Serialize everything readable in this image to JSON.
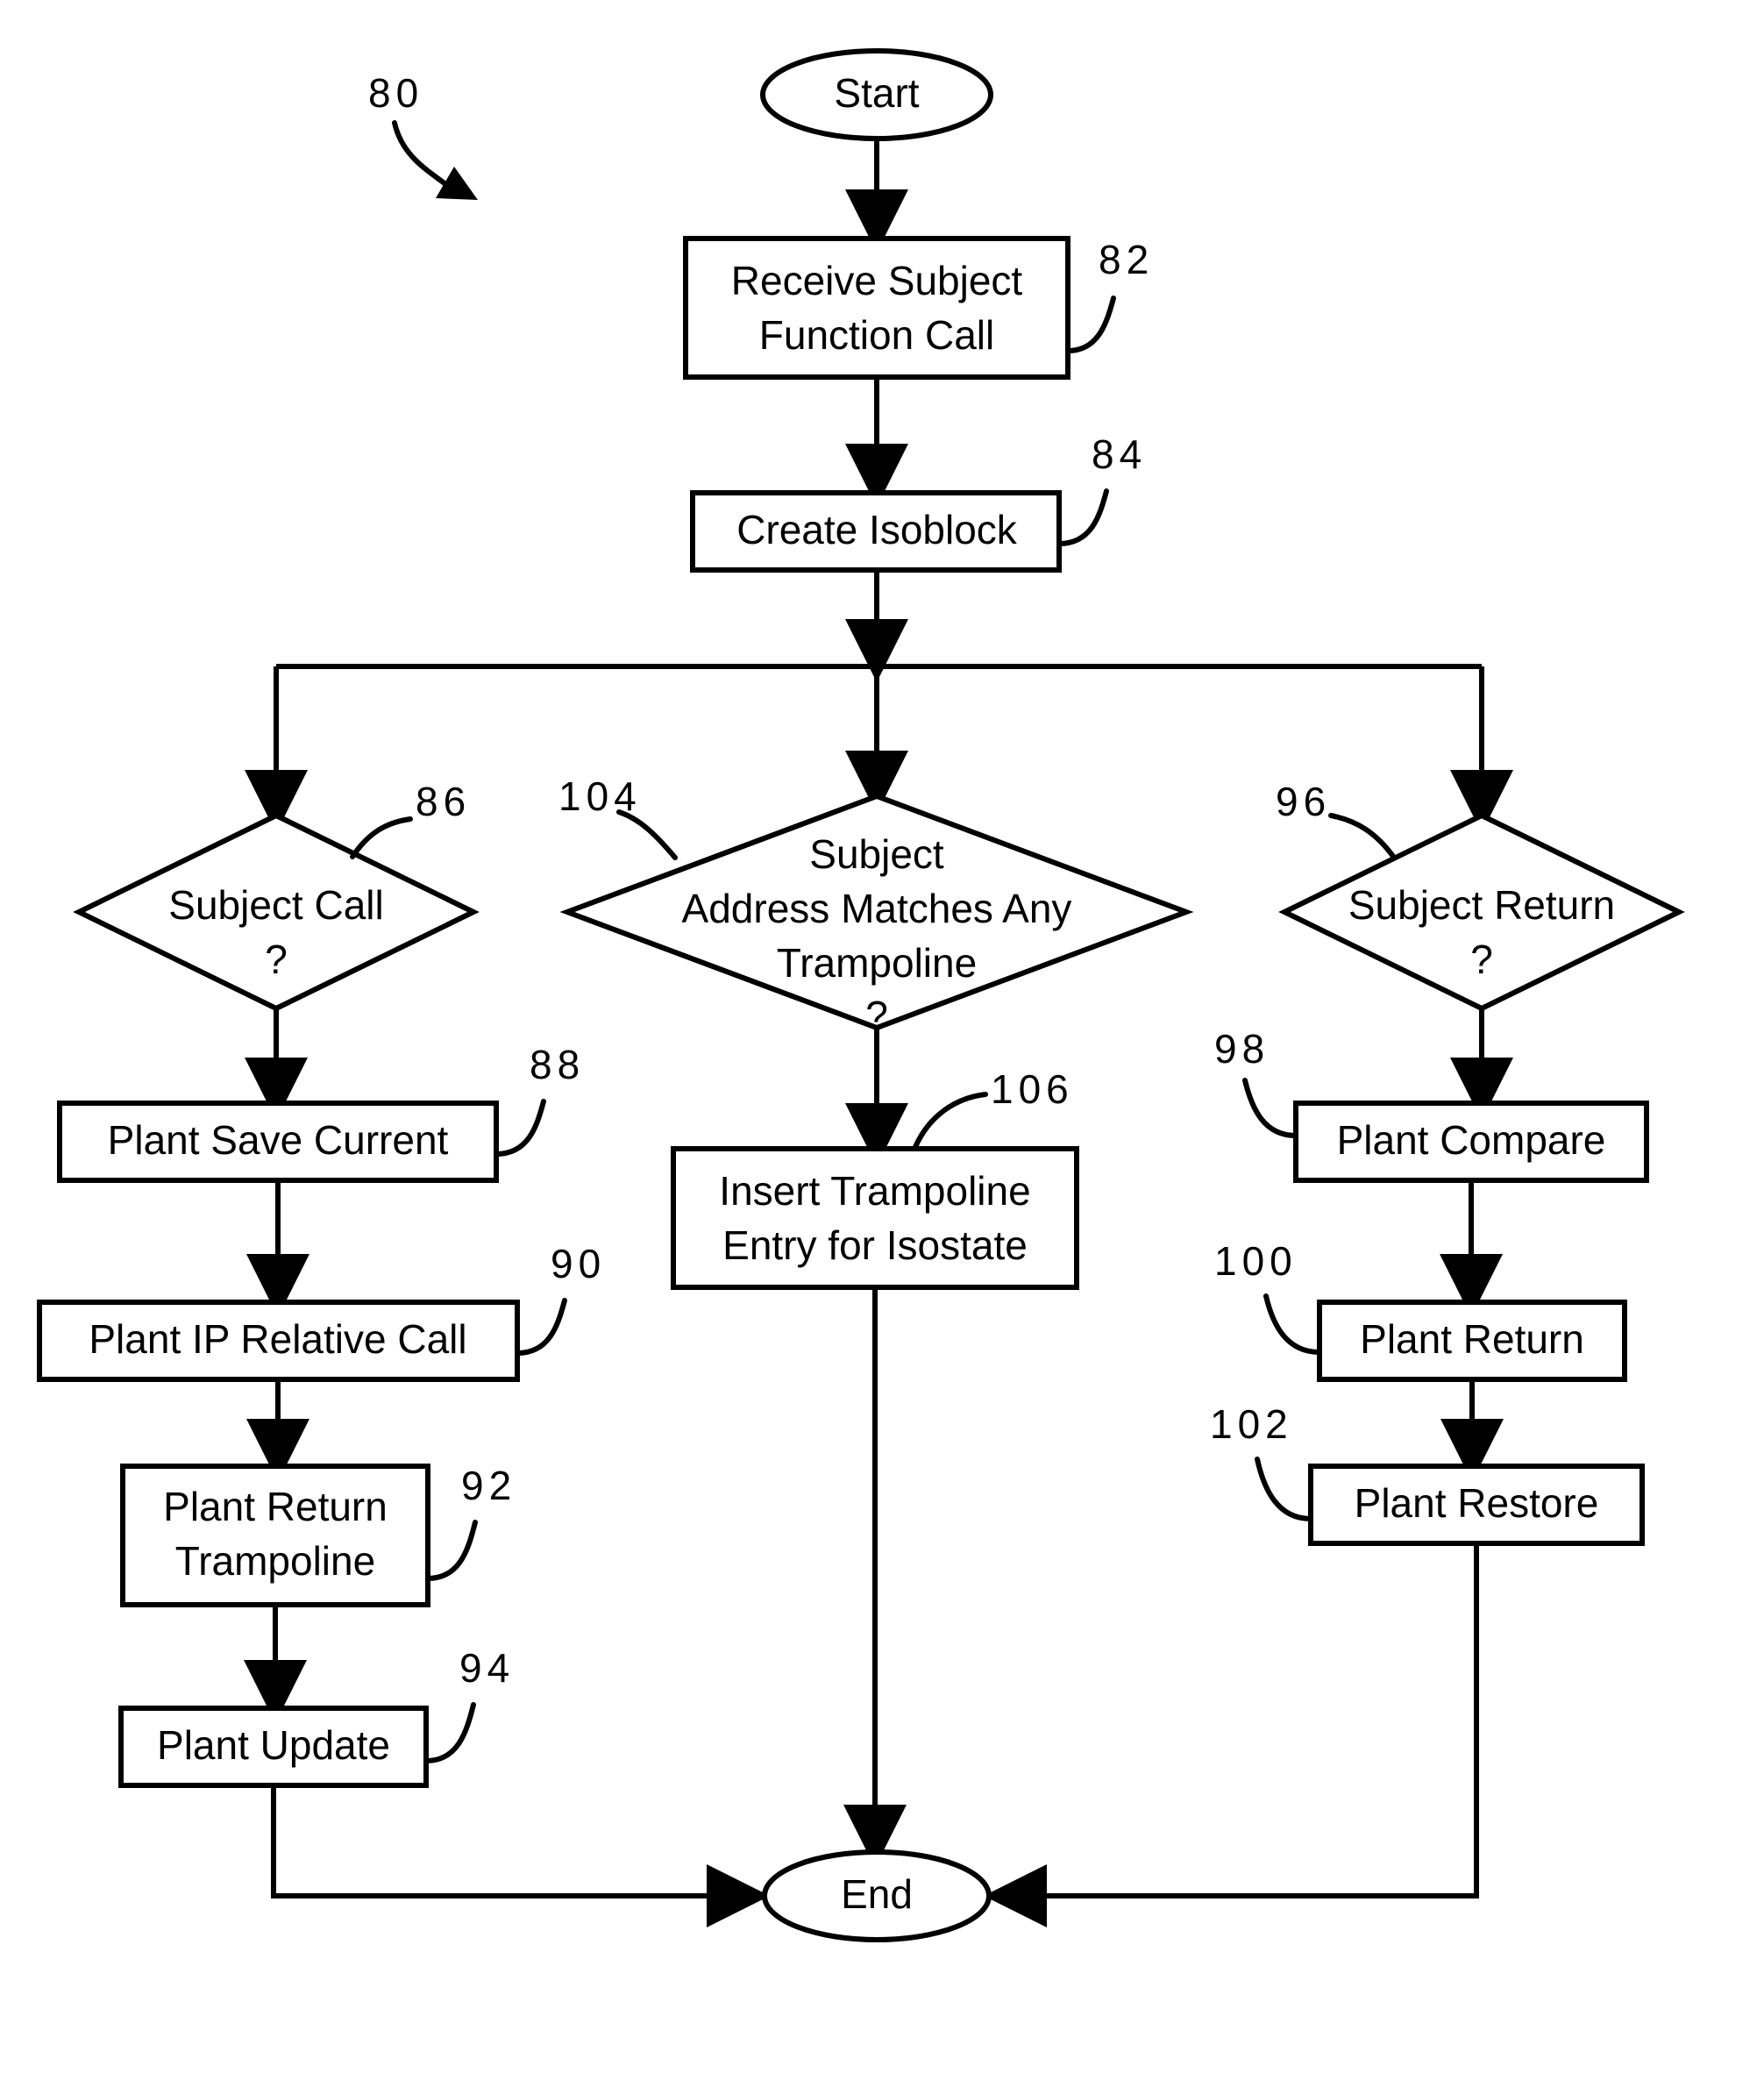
{
  "figure": {
    "figure_ref": "80",
    "title": ""
  },
  "nodes": {
    "start": {
      "label": "Start",
      "shape": "ellipse"
    },
    "end": {
      "label": "End",
      "shape": "ellipse"
    },
    "receive_call": {
      "label_line1": "Receive Subject",
      "label_line2": "Function Call",
      "ref": "82",
      "shape": "process"
    },
    "create_isoblock": {
      "label": "Create Isoblock",
      "ref": "84",
      "shape": "process"
    },
    "subject_call": {
      "label_line1": "Subject Call",
      "label_line2": "?",
      "ref": "86",
      "shape": "decision"
    },
    "plant_save_current": {
      "label": "Plant Save Current",
      "ref": "88",
      "shape": "process"
    },
    "plant_ip_relative_call": {
      "label": "Plant IP Relative Call",
      "ref": "90",
      "shape": "process"
    },
    "plant_return_trampoline": {
      "label_line1": "Plant Return",
      "label_line2": "Trampoline",
      "ref": "92",
      "shape": "process"
    },
    "plant_update": {
      "label": "Plant Update",
      "ref": "94",
      "shape": "process"
    },
    "subject_return": {
      "label_line1": "Subject Return",
      "label_line2": "?",
      "ref": "96",
      "shape": "decision"
    },
    "plant_compare": {
      "label": "Plant Compare",
      "ref": "98",
      "shape": "process"
    },
    "plant_return": {
      "label": "Plant Return",
      "ref": "100",
      "shape": "process"
    },
    "plant_restore": {
      "label": "Plant Restore",
      "ref": "102",
      "shape": "process"
    },
    "address_matches": {
      "label_line1": "Subject",
      "label_line2": "Address Matches Any",
      "label_line3": "Trampoline",
      "label_line4": "?",
      "ref": "104",
      "shape": "decision"
    },
    "insert_trampoline": {
      "label_line1": "Insert Trampoline",
      "label_line2": "Entry for Isostate",
      "ref": "106",
      "shape": "process"
    }
  },
  "colors": {
    "stroke": "#000000",
    "fill": "#ffffff",
    "text": "#000000"
  }
}
